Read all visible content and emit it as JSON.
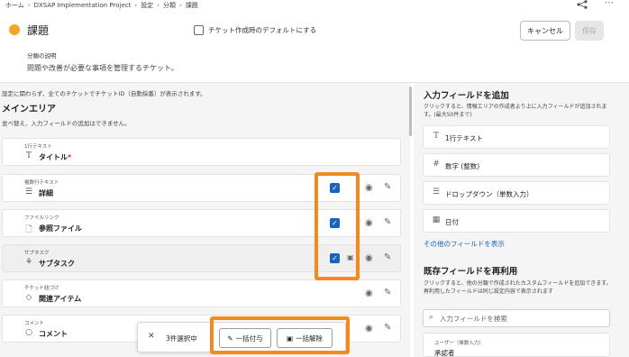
{
  "breadcrumb": {
    "items": [
      "ホーム",
      "DXSAP Implementation Project",
      "設定",
      "分類",
      "課題"
    ]
  },
  "header": {
    "category_name": "課題",
    "category_color": "#f5a623",
    "default_checkbox_label": "チケット作成時のデフォルトにする",
    "cancel_label": "キャンセル",
    "save_label": "保存",
    "description_label": "分類の説明",
    "description_text": "問題や改善が必要な事項を管理するチケット。"
  },
  "main": {
    "note": "設定に関わらず、全てのチケットでチケットID（自動採番）が表示されます。",
    "title": "メインエリア",
    "subtitle": "並べ替え、入力フィールドの追加はできません。",
    "fields": [
      {
        "type": "1行テキスト",
        "name": "タイトル",
        "required": "*",
        "icon": "text-icon",
        "selected": false
      },
      {
        "type": "複数行テキスト",
        "name": "詳細",
        "icon": "multiline-icon",
        "selected": true
      },
      {
        "type": "ファイルリンク",
        "name": "参照ファイル",
        "icon": "file-icon",
        "selected": true
      },
      {
        "type": "サブタスク",
        "name": "サブタスク",
        "icon": "subtask-icon",
        "selected": true
      },
      {
        "type": "チケット紐づけ",
        "name": "関連アイテム",
        "icon": "tag-icon",
        "selected": false
      },
      {
        "type": "コメント",
        "name": "コメント",
        "icon": "comment-icon",
        "selected": false
      }
    ]
  },
  "selection_bar": {
    "count_label": "3件選択中",
    "bulk_assign_label": "一括付与",
    "bulk_unassign_label": "一括解除"
  },
  "right_panel": {
    "add_title": "入力フィールドを追加",
    "add_description": "クリックすると、情報エリアの作成者より上に入力フィールドが追加されます。(最大50件まで)",
    "field_types": [
      {
        "label": "1行テキスト",
        "icon": "text-icon"
      },
      {
        "label": "数字 (整数)",
        "icon": "hash-icon"
      },
      {
        "label": "ドロップダウン（単数入力）",
        "icon": "list-icon"
      },
      {
        "label": "日付",
        "icon": "calendar-icon"
      }
    ],
    "other_fields_link": "その他のフィールドを表示",
    "reuse_title": "既存フィールドを再利用",
    "reuse_description": "クリックすると、他の分類で作成されたカスタムフィールドを追加できます。再利用したフィールドは同じ設定内容で表示されます",
    "search_placeholder": "入力フィールドを検索",
    "existing_field": {
      "type": "ユーザー（単数入力）",
      "name": "承認者"
    }
  },
  "colors": {
    "accent": "#1565c0",
    "highlight": "#f5891f"
  }
}
